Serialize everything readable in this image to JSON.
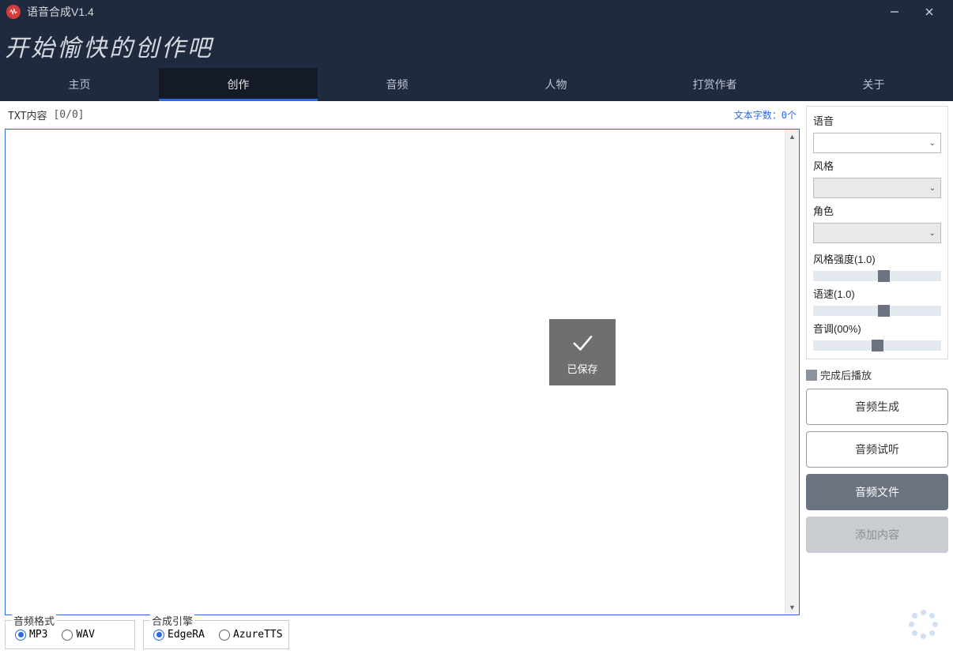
{
  "titlebar": {
    "title": "语音合成V1.4"
  },
  "banner": "开始愉快的创作吧",
  "tabs": [
    {
      "label": "主页",
      "active": false
    },
    {
      "label": "创作",
      "active": true
    },
    {
      "label": "音频",
      "active": false
    },
    {
      "label": "人物",
      "active": false
    },
    {
      "label": "打赏作者",
      "active": false
    },
    {
      "label": "关于",
      "active": false
    }
  ],
  "txt": {
    "label": "TXT内容",
    "counter": "[0/0]",
    "charcount": "文本字数：0个",
    "value": ""
  },
  "toast": "已保存",
  "audio_format": {
    "legend": "音频格式",
    "options": [
      {
        "label": "MP3",
        "selected": true
      },
      {
        "label": "WAV",
        "selected": false
      }
    ]
  },
  "engine": {
    "legend": "合成引擎",
    "options": [
      {
        "label": "EdgeRA",
        "selected": true
      },
      {
        "label": "AzureTTS",
        "selected": false
      }
    ]
  },
  "side": {
    "voice_label": "语音",
    "style_label": "风格",
    "role_label": "角色",
    "style_strength_label": "风格强度(1.0)",
    "speed_label": "语速(1.0)",
    "pitch_label": "音调(00%)",
    "play_after_label": "完成后播放",
    "sliders": {
      "style_strength_pct": 56,
      "speed_pct": 56,
      "pitch_pct": 50
    },
    "buttons": {
      "generate": "音频生成",
      "preview": "音频试听",
      "file": "音频文件",
      "add": "添加内容"
    }
  }
}
